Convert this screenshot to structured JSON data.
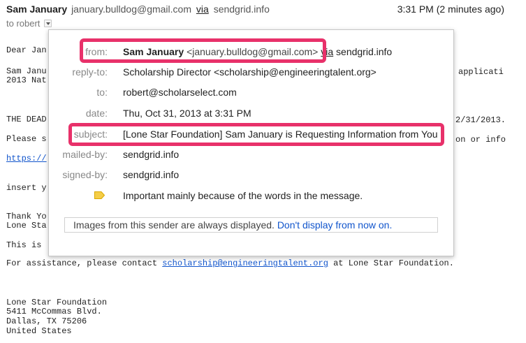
{
  "header": {
    "sender_name": "Sam January",
    "sender_email": "january.bulldog@gmail.com",
    "via_text": "via",
    "via_domain": "sendgrid.info",
    "time": "3:31 PM (2 minutes ago)",
    "to_text": "to robert"
  },
  "body": {
    "lines": [
      "Dear Jan",
      "Sam Janu",
      "2013 Nat",
      "THE DEAD",
      "Please s",
      "https://",
      "insert y",
      "Thank Yo",
      "Lone Sta",
      "This is",
      "For assistance, please contact ",
      "Lone Star Foundation",
      "5411 McCommas Blvd.",
      "Dallas, TX 75206",
      "United States"
    ],
    "assist_email": "scholarship@engineeringtalent.org",
    "assist_suffix": " at Lone Star Foundation.",
    "frag_applicati": "applicati",
    "frag_date": "2/31/2013.",
    "frag_oninfo": "on or info"
  },
  "details": {
    "from_label": "from:",
    "from_name": "Sam January",
    "from_email": "<january.bulldog@gmail.com>",
    "from_via": "via",
    "from_domain": "sendgrid.info",
    "replyto_label": "reply-to:",
    "replyto_value": "Scholarship Director <scholarship@engineeringtalent.org>",
    "to_label": "to:",
    "to_value": "robert@scholarselect.com",
    "date_label": "date:",
    "date_value": "Thu, Oct 31, 2013 at 3:31 PM",
    "subject_label": "subject:",
    "subject_value": "[Lone Star Foundation] Sam January is Requesting Information from You",
    "mailedby_label": "mailed-by:",
    "mailedby_value": "sendgrid.info",
    "signedby_label": "signed-by:",
    "signedby_value": "sendgrid.info",
    "importance_text": "Important mainly because of the words in the message.",
    "images_text": "Images from this sender are always displayed.",
    "images_link": "Don't display from now on."
  },
  "colors": {
    "highlight": "#e8316a",
    "link": "#1155cc",
    "importance_marker": "#f5cd47"
  },
  "icons": {
    "to_toggle": "chevron-down-icon",
    "importance": "importance-marker-icon"
  }
}
